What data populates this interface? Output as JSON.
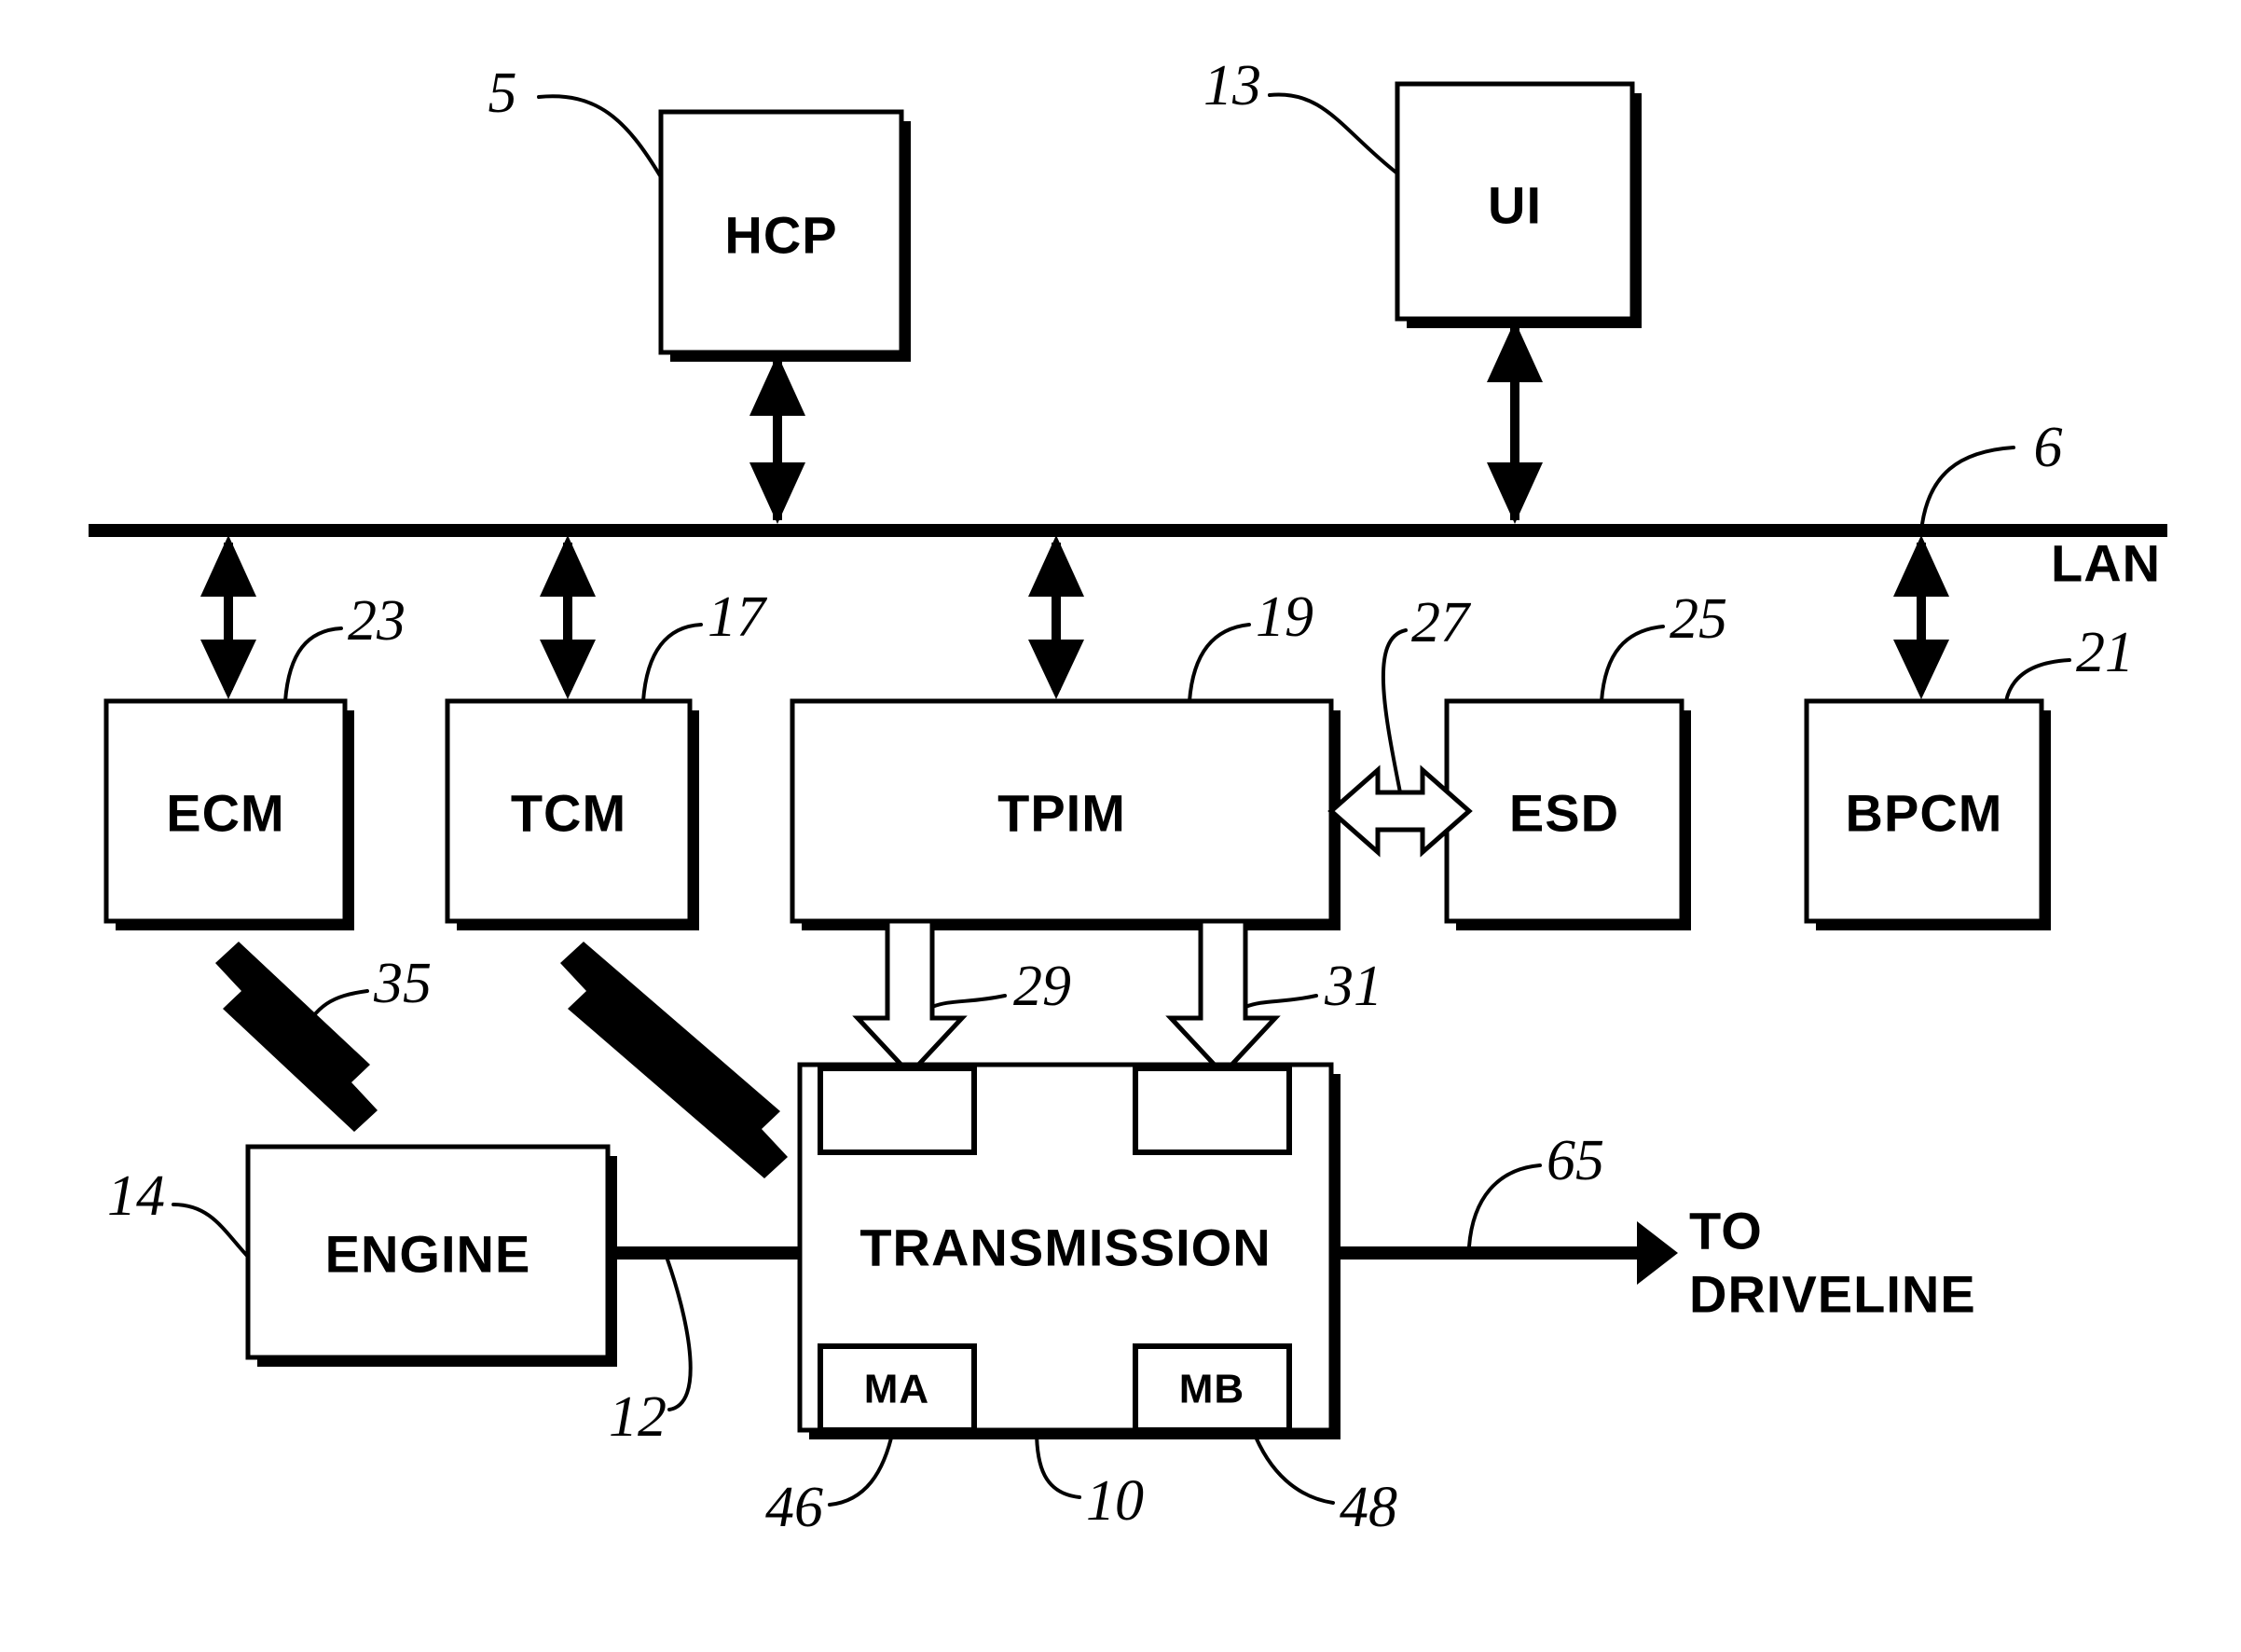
{
  "figure": {
    "kind": "patent-block-diagram",
    "subject": "Hybrid powertrain control system architecture",
    "background_color": "#ffffff",
    "line_color": "#000000"
  },
  "bus": {
    "name": "LAN",
    "label": "LAN",
    "ref": "6"
  },
  "blocks": [
    {
      "id": "hcp",
      "label": "HCP",
      "ref": "5"
    },
    {
      "id": "ui",
      "label": "UI",
      "ref": "13"
    },
    {
      "id": "ecm",
      "label": "ECM",
      "ref": "23"
    },
    {
      "id": "tcm",
      "label": "TCM",
      "ref": "17"
    },
    {
      "id": "tpim",
      "label": "TPIM",
      "ref": "19"
    },
    {
      "id": "esd",
      "label": "ESD",
      "ref": "25"
    },
    {
      "id": "bpcm",
      "label": "BPCM",
      "ref": "21"
    },
    {
      "id": "engine",
      "label": "ENGINE",
      "ref": "14"
    },
    {
      "id": "transmission",
      "label": "TRANSMISSION",
      "ref": "10"
    },
    {
      "id": "machine_a",
      "label": "MA",
      "ref": "46"
    },
    {
      "id": "machine_b",
      "label": "MB",
      "ref": "48"
    }
  ],
  "connections": [
    {
      "id": "tpim_esd",
      "ref": "27",
      "style": "hollow-double-arrow",
      "from": "tpim",
      "to": "esd"
    },
    {
      "id": "tpim_ma",
      "ref": "29",
      "style": "hollow-arrow-down",
      "from": "tpim",
      "to": "machine_a"
    },
    {
      "id": "tpim_mb",
      "ref": "31",
      "style": "hollow-arrow-down",
      "from": "tpim",
      "to": "machine_b"
    },
    {
      "id": "ecm_engine",
      "ref": "35",
      "style": "solid-double-arrow",
      "from": "ecm",
      "to": "engine"
    },
    {
      "id": "engine_shaft",
      "ref": "12",
      "style": "solid-shaft",
      "from": "engine",
      "to": "transmission"
    },
    {
      "id": "output_shaft",
      "ref": "65",
      "style": "solid-arrow-right",
      "from": "transmission",
      "to": "driveline"
    }
  ],
  "output": {
    "line1": "TO",
    "line2": "DRIVELINE"
  }
}
